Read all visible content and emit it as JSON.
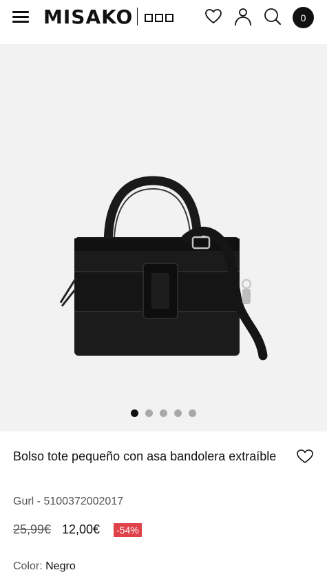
{
  "header": {
    "logo": "MISAKO",
    "logo_sub": "",
    "cart_count": "0"
  },
  "gallery": {
    "slide_count": 5,
    "active_index": 0
  },
  "product": {
    "title": "Bolso tote pequeño con asa bandolera extraíble",
    "sku": "Gurl - 5100372002017",
    "old_price": "25,99€",
    "price": "12,00€",
    "discount": "-54%",
    "color_label": "Color:",
    "color_value": "Negro"
  },
  "colors": {
    "accent_discount": "#e0424a",
    "gallery_bg": "#f2f2f2",
    "text": "#111111"
  }
}
